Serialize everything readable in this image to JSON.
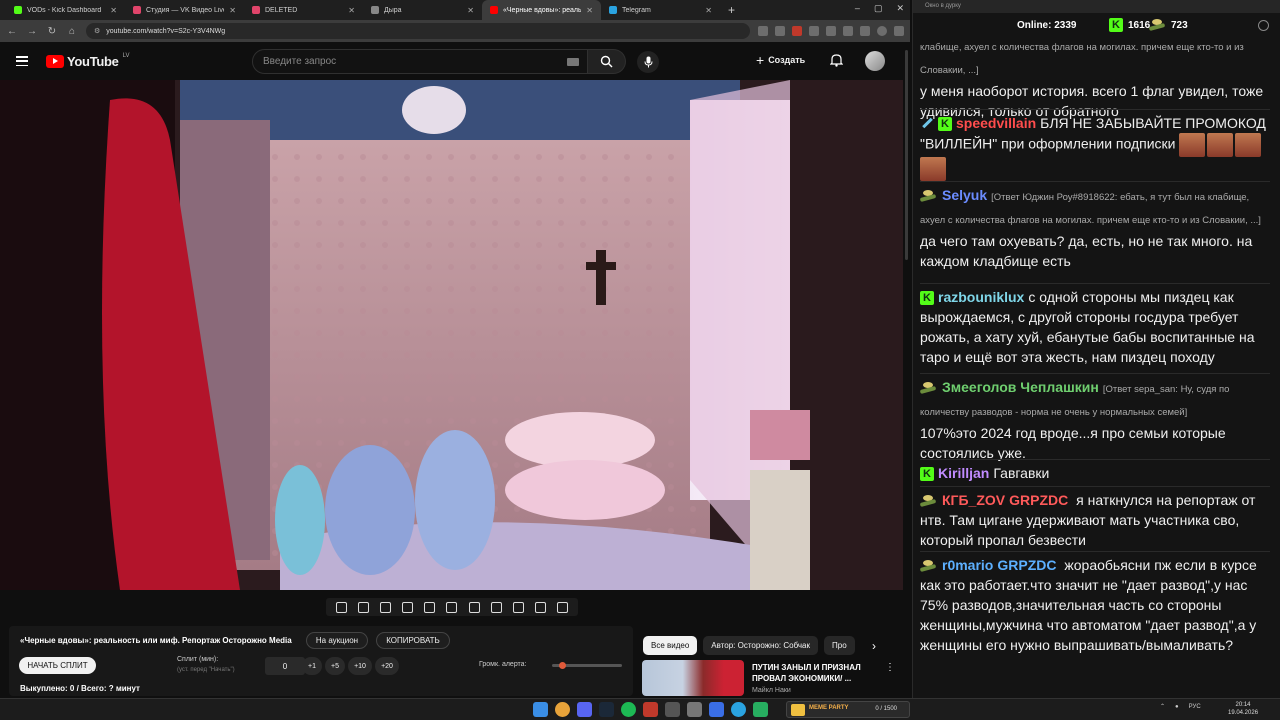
{
  "browser": {
    "tabs": [
      {
        "title": "VODs - Kick Dashboard",
        "fav": "#53fc18",
        "active": false
      },
      {
        "title": "Студия — VK Видео Live",
        "fav": "#e0446a",
        "active": false
      },
      {
        "title": "DELETED",
        "fav": "#e0446a",
        "active": false
      },
      {
        "title": "Дыра",
        "fav": "#888888",
        "active": false
      },
      {
        "title": "«Черные вдовы»: реальн",
        "fav": "#ff0000",
        "active": true
      },
      {
        "title": "Telegram",
        "fav": "#2aa3e0",
        "active": false
      }
    ],
    "url": "youtube.com/watch?v=S2c-Y3V4NWg",
    "window_controls": [
      "–",
      "▢",
      "✕"
    ]
  },
  "youtube": {
    "logo_text": "YouTube",
    "region": "LV",
    "search_placeholder": "Введите запрос",
    "create_label": "Создать"
  },
  "panel": {
    "video_title": "«Черные вдовы»: реальность или миф. Репортаж Осторожно Media",
    "auction_btn": "На аукцион",
    "copy_btn": "КОПИРОВАТЬ",
    "start_split_btn": "НАЧАТЬ СПЛИТ",
    "split_label": "Сплит (мин):",
    "split_sub": "(уст. перед \"Начать\")",
    "split_value": "0",
    "increments": [
      "+1",
      "+5",
      "+10",
      "+20"
    ],
    "volume_label": "Громк. алерта:",
    "volume_level": 0.1,
    "status": "Выкуплено: 0 / Всего: ? минут"
  },
  "chips": [
    "Все видео",
    "Автор: Осторожно: Собчак",
    "Про"
  ],
  "recommendation": {
    "title": "ПУТИН ЗАНЫЛ И ПРИЗНАЛ ПРОВАЛ ЭКОНОМИКИ/ ...",
    "author": "Майкл Наки"
  },
  "chat": {
    "window_title": "Окно в дурку",
    "online_label": "Online:",
    "online_count": "2339",
    "kick_count": "1616",
    "other_count": "723",
    "messages": [
      {
        "user": "",
        "color": "#ffffff",
        "reply": "клабище, ахуел с количества флагов на могилах. причем еще кто-то и из Словакии, ...]",
        "text": "у меня наоборот история. всего 1 флаг увидел, тоже удивился, только от обратного",
        "mention": ""
      },
      {
        "user": "speedvillain",
        "color": "#ff4d4d",
        "reply": "",
        "text": "БЛЯ НЕ ЗАБЫВАЙТЕ ПРОМОКОД \"ВИЛЛЕЙН\" при оформлении подписки",
        "mention": ""
      },
      {
        "user": "Selyuk",
        "color": "#6b8cff",
        "reply": "[Ответ Юджин Роу#8918622: ебать, я тут был на клабище, ахуел с количества флагов на могилах. причем еще кто-то и из Словакии, ...]",
        "text": "да чего там охуевать? да, есть, но не так много. на каждом кладбище есть",
        "mention": ""
      },
      {
        "user": "razbouniklux",
        "color": "#7fd6e8",
        "reply": "",
        "text": "с одной стороны мы пиздец как вырождаемся, с другой стороны госдура требует рожать, а хату хуй, ебанутые бабы воспитанные на таро и ещё вот эта жесть, нам пиздец походу",
        "mention": ""
      },
      {
        "user": "Змееголов Чеплашкин",
        "color": "#6fcf6f",
        "reply": "[Ответ sepa_san: Ну, судя по количеству разводов - норма не очень у нормальных семей]",
        "text": "107%это 2024 год вроде...я про семьи которые состоялись уже.",
        "mention": ""
      },
      {
        "user": "Kirilljan",
        "color": "#c08bff",
        "reply": "",
        "text": "Гавгавки",
        "mention": ""
      },
      {
        "user": "КГБ_ZOV",
        "color": "#ff5a5a",
        "reply": "",
        "text": "я наткнулся на репортаж от нтв. Там цигане удерживают мать участника сво, который пропал безвести",
        "mention": "GRPZDC"
      },
      {
        "user": "r0mario",
        "color": "#5db0ff",
        "reply": "",
        "text": "жораобьясни пж если в курсе как это работает.что значит не \"дает развод\",у нас 75% разводов,значительная часть со стороны женщины,мужчина что автоматом \"дает развод\",а у женщины его нужно выпрашивать/вымаливать?",
        "mention": "GRPZDC"
      }
    ]
  },
  "taskbar": {
    "meme_label": "MEME PARTY",
    "meme_count": "0 / 1500",
    "lang": "РУС",
    "time": "20:14",
    "date": "19.04.2026"
  }
}
